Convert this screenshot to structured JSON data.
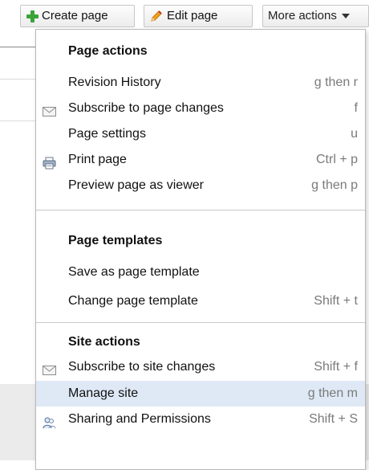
{
  "toolbar": {
    "create_label": "Create page",
    "edit_label": "Edit page",
    "more_label": "More actions"
  },
  "menu": {
    "sections": [
      {
        "header": "Page actions",
        "items": [
          {
            "label": "Revision History",
            "shortcut": "g then r",
            "icon": ""
          },
          {
            "label": "Subscribe to page changes",
            "shortcut": "f",
            "icon": "envelope-icon"
          },
          {
            "label": "Page settings",
            "shortcut": "u",
            "icon": ""
          },
          {
            "label": "Print page",
            "shortcut": "Ctrl + p",
            "icon": "printer-icon"
          },
          {
            "label": "Preview page as viewer",
            "shortcut": "g then p",
            "icon": ""
          }
        ]
      },
      {
        "header": "Page templates",
        "items": [
          {
            "label": "Save as page template",
            "shortcut": "",
            "icon": ""
          },
          {
            "label": "Change page template",
            "shortcut": "Shift + t",
            "icon": ""
          }
        ]
      },
      {
        "header": "Site actions",
        "items": [
          {
            "label": "Subscribe to site changes",
            "shortcut": "Shift + f",
            "icon": "envelope-icon"
          },
          {
            "label": "Manage site",
            "shortcut": "g then m",
            "icon": "",
            "selected": true
          },
          {
            "label": "Sharing and Permissions",
            "shortcut": "Shift + S",
            "icon": "users-icon"
          }
        ]
      }
    ]
  },
  "colors": {
    "selected_bg": "#dfe9f6",
    "shortcut_text": "#7a7a7a",
    "plus_green": "#3aa33a",
    "pencil_orange": "#f0a020"
  }
}
